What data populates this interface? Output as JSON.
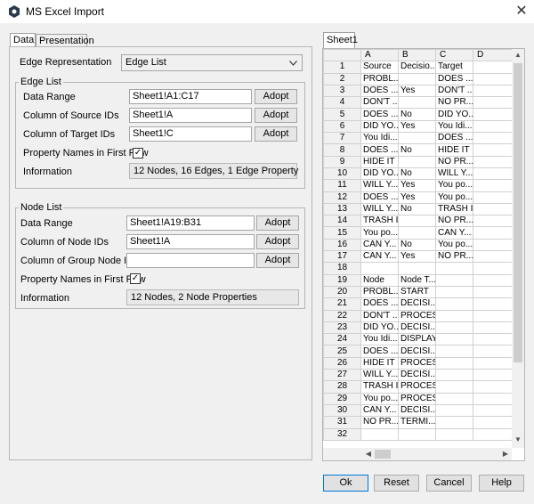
{
  "window": {
    "title": "MS Excel Import",
    "close_glyph": "✕"
  },
  "tabs": [
    {
      "label": "Data",
      "active": true
    },
    {
      "label": "Presentation",
      "active": false
    }
  ],
  "edge_representation": {
    "label": "Edge Representation",
    "value": "Edge List"
  },
  "edge_list": {
    "title": "Edge List",
    "data_range": {
      "label": "Data Range",
      "value": "Sheet1!A1:C17",
      "button": "Adopt"
    },
    "source_ids": {
      "label": "Column of Source IDs",
      "value": "Sheet1!A",
      "button": "Adopt"
    },
    "target_ids": {
      "label": "Column of Target IDs",
      "value": "Sheet1!C",
      "button": "Adopt"
    },
    "property_names": {
      "label": "Property Names in First Row",
      "checked": true
    },
    "information": {
      "label": "Information",
      "value": "12 Nodes, 16 Edges, 1 Edge Property"
    }
  },
  "node_list": {
    "title": "Node List",
    "data_range": {
      "label": "Data Range",
      "value": "Sheet1!A19:B31",
      "button": "Adopt"
    },
    "node_ids": {
      "label": "Column of Node IDs",
      "value": "Sheet1!A",
      "button": "Adopt"
    },
    "group_ids": {
      "label": "Column of Group Node IDs",
      "value": "",
      "button": "Adopt"
    },
    "property_names": {
      "label": "Property Names in First Row",
      "checked": true
    },
    "information": {
      "label": "Information",
      "value": "12 Nodes, 2 Node Properties"
    }
  },
  "sheet": {
    "tab": "Sheet1",
    "columns": [
      "A",
      "B",
      "C",
      "D"
    ],
    "rows": [
      [
        "1",
        "Source",
        "Decisio...",
        "Target",
        ""
      ],
      [
        "2",
        "PROBL...",
        "",
        "DOES ...",
        ""
      ],
      [
        "3",
        "DOES ...",
        "Yes",
        "DON'T ...",
        ""
      ],
      [
        "4",
        "DON'T ...",
        "",
        "NO PR...",
        ""
      ],
      [
        "5",
        "DOES ...",
        "No",
        "DID YO...",
        ""
      ],
      [
        "6",
        "DID YO...",
        "Yes",
        "You Idi...",
        ""
      ],
      [
        "7",
        "You Idi...",
        "",
        "DOES ...",
        ""
      ],
      [
        "8",
        "DOES ...",
        "No",
        "HIDE IT",
        ""
      ],
      [
        "9",
        "HIDE IT",
        "",
        "NO PR...",
        ""
      ],
      [
        "10",
        "DID YO...",
        "No",
        "WILL Y...",
        ""
      ],
      [
        "11",
        "WILL Y...",
        "Yes",
        "You po...",
        ""
      ],
      [
        "12",
        "DOES ...",
        "Yes",
        "You po...",
        ""
      ],
      [
        "13",
        "WILL Y...",
        "No",
        "TRASH IT",
        ""
      ],
      [
        "14",
        "TRASH IT",
        "",
        "NO PR...",
        ""
      ],
      [
        "15",
        "You po...",
        "",
        "CAN Y...",
        ""
      ],
      [
        "16",
        "CAN Y...",
        "No",
        "You po...",
        ""
      ],
      [
        "17",
        "CAN Y...",
        "Yes",
        "NO PR...",
        ""
      ],
      [
        "18",
        "",
        "",
        "",
        ""
      ],
      [
        "19",
        "Node",
        "Node T...",
        "",
        ""
      ],
      [
        "20",
        "PROBL...",
        "START",
        "",
        ""
      ],
      [
        "21",
        "DOES ...",
        "DECISI...",
        "",
        ""
      ],
      [
        "22",
        "DON'T ...",
        "PROCESS",
        "",
        ""
      ],
      [
        "23",
        "DID YO...",
        "DECISI...",
        "",
        ""
      ],
      [
        "24",
        "You Idi...",
        "DISPLAY",
        "",
        ""
      ],
      [
        "25",
        "DOES ...",
        "DECISI...",
        "",
        ""
      ],
      [
        "26",
        "HIDE IT",
        "PROCESS",
        "",
        ""
      ],
      [
        "27",
        "WILL Y...",
        "DECISI...",
        "",
        ""
      ],
      [
        "28",
        "TRASH IT",
        "PROCESS",
        "",
        ""
      ],
      [
        "29",
        "You po...",
        "PROCESS",
        "",
        ""
      ],
      [
        "30",
        "CAN Y...",
        "DECISI...",
        "",
        ""
      ],
      [
        "31",
        "NO PR...",
        "TERMI...",
        "",
        ""
      ],
      [
        "32",
        "",
        "",
        "",
        ""
      ]
    ]
  },
  "footer": {
    "ok": "Ok",
    "reset": "Reset",
    "cancel": "Cancel",
    "help": "Help"
  },
  "icons": {
    "app": "app-logo-icon",
    "dropdown": "chevron-down-icon",
    "check": "✓",
    "arrow_up": "▲",
    "arrow_down": "▼",
    "arrow_left": "◀",
    "arrow_right": "▶"
  }
}
